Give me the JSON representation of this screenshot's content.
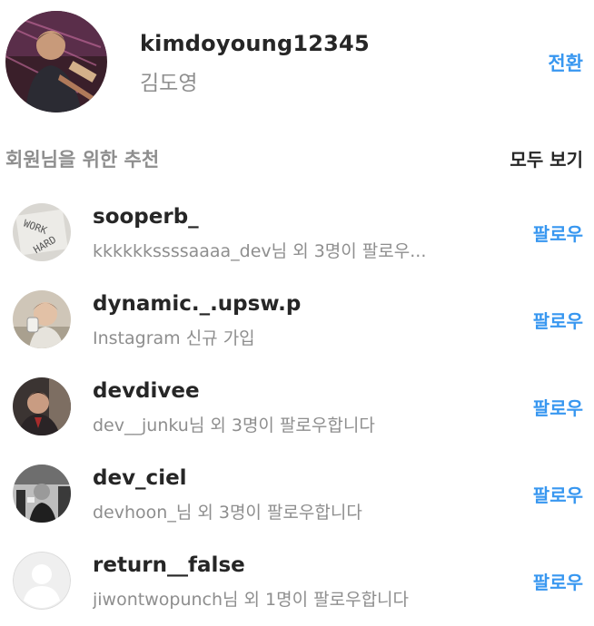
{
  "profile": {
    "username": "kimdoyoung12345",
    "full_name": "김도영",
    "switch_label": "전환"
  },
  "suggestions_header": {
    "title": "회원님을 위한 추천",
    "see_all_label": "모두 보기"
  },
  "suggestions": [
    {
      "username": "sooperb_",
      "meta": "kkkkkkssssaaaa_dev님 외 3명이 팔로우...",
      "follow_label": "팔로우",
      "avatar": "work-hard-avatar"
    },
    {
      "username": "dynamic._.upsw.p",
      "meta": "Instagram 신규 가입",
      "follow_label": "팔로우",
      "avatar": "person-avatar"
    },
    {
      "username": "devdivee",
      "meta": "dev__junku님 외 3명이 팔로우합니다",
      "follow_label": "팔로우",
      "avatar": "person-avatar"
    },
    {
      "username": "dev_ciel",
      "meta": "devhoon_님 외 3명이 팔로우합니다",
      "follow_label": "팔로우",
      "avatar": "person-avatar"
    },
    {
      "username": "return__false",
      "meta": "jiwontwopunch님 외 1명이 팔로우합니다",
      "follow_label": "팔로우",
      "avatar": "default-avatar"
    }
  ],
  "colors": {
    "link_blue": "#3897f0",
    "text_dark": "#262626",
    "text_gray": "#8e8e8e"
  }
}
